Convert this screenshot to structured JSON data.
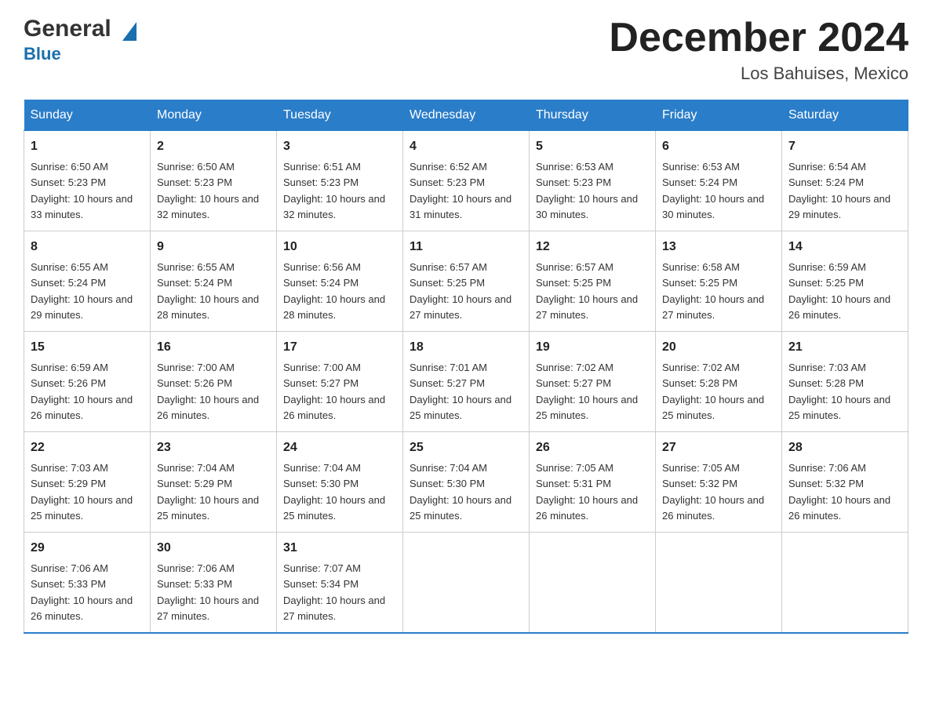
{
  "header": {
    "logo_general": "General",
    "logo_blue": "Blue",
    "month_title": "December 2024",
    "location": "Los Bahuises, Mexico"
  },
  "days_of_week": [
    "Sunday",
    "Monday",
    "Tuesday",
    "Wednesday",
    "Thursday",
    "Friday",
    "Saturday"
  ],
  "weeks": [
    [
      {
        "day": "1",
        "sunrise": "6:50 AM",
        "sunset": "5:23 PM",
        "daylight": "10 hours and 33 minutes."
      },
      {
        "day": "2",
        "sunrise": "6:50 AM",
        "sunset": "5:23 PM",
        "daylight": "10 hours and 32 minutes."
      },
      {
        "day": "3",
        "sunrise": "6:51 AM",
        "sunset": "5:23 PM",
        "daylight": "10 hours and 32 minutes."
      },
      {
        "day": "4",
        "sunrise": "6:52 AM",
        "sunset": "5:23 PM",
        "daylight": "10 hours and 31 minutes."
      },
      {
        "day": "5",
        "sunrise": "6:53 AM",
        "sunset": "5:23 PM",
        "daylight": "10 hours and 30 minutes."
      },
      {
        "day": "6",
        "sunrise": "6:53 AM",
        "sunset": "5:24 PM",
        "daylight": "10 hours and 30 minutes."
      },
      {
        "day": "7",
        "sunrise": "6:54 AM",
        "sunset": "5:24 PM",
        "daylight": "10 hours and 29 minutes."
      }
    ],
    [
      {
        "day": "8",
        "sunrise": "6:55 AM",
        "sunset": "5:24 PM",
        "daylight": "10 hours and 29 minutes."
      },
      {
        "day": "9",
        "sunrise": "6:55 AM",
        "sunset": "5:24 PM",
        "daylight": "10 hours and 28 minutes."
      },
      {
        "day": "10",
        "sunrise": "6:56 AM",
        "sunset": "5:24 PM",
        "daylight": "10 hours and 28 minutes."
      },
      {
        "day": "11",
        "sunrise": "6:57 AM",
        "sunset": "5:25 PM",
        "daylight": "10 hours and 27 minutes."
      },
      {
        "day": "12",
        "sunrise": "6:57 AM",
        "sunset": "5:25 PM",
        "daylight": "10 hours and 27 minutes."
      },
      {
        "day": "13",
        "sunrise": "6:58 AM",
        "sunset": "5:25 PM",
        "daylight": "10 hours and 27 minutes."
      },
      {
        "day": "14",
        "sunrise": "6:59 AM",
        "sunset": "5:25 PM",
        "daylight": "10 hours and 26 minutes."
      }
    ],
    [
      {
        "day": "15",
        "sunrise": "6:59 AM",
        "sunset": "5:26 PM",
        "daylight": "10 hours and 26 minutes."
      },
      {
        "day": "16",
        "sunrise": "7:00 AM",
        "sunset": "5:26 PM",
        "daylight": "10 hours and 26 minutes."
      },
      {
        "day": "17",
        "sunrise": "7:00 AM",
        "sunset": "5:27 PM",
        "daylight": "10 hours and 26 minutes."
      },
      {
        "day": "18",
        "sunrise": "7:01 AM",
        "sunset": "5:27 PM",
        "daylight": "10 hours and 25 minutes."
      },
      {
        "day": "19",
        "sunrise": "7:02 AM",
        "sunset": "5:27 PM",
        "daylight": "10 hours and 25 minutes."
      },
      {
        "day": "20",
        "sunrise": "7:02 AM",
        "sunset": "5:28 PM",
        "daylight": "10 hours and 25 minutes."
      },
      {
        "day": "21",
        "sunrise": "7:03 AM",
        "sunset": "5:28 PM",
        "daylight": "10 hours and 25 minutes."
      }
    ],
    [
      {
        "day": "22",
        "sunrise": "7:03 AM",
        "sunset": "5:29 PM",
        "daylight": "10 hours and 25 minutes."
      },
      {
        "day": "23",
        "sunrise": "7:04 AM",
        "sunset": "5:29 PM",
        "daylight": "10 hours and 25 minutes."
      },
      {
        "day": "24",
        "sunrise": "7:04 AM",
        "sunset": "5:30 PM",
        "daylight": "10 hours and 25 minutes."
      },
      {
        "day": "25",
        "sunrise": "7:04 AM",
        "sunset": "5:30 PM",
        "daylight": "10 hours and 25 minutes."
      },
      {
        "day": "26",
        "sunrise": "7:05 AM",
        "sunset": "5:31 PM",
        "daylight": "10 hours and 26 minutes."
      },
      {
        "day": "27",
        "sunrise": "7:05 AM",
        "sunset": "5:32 PM",
        "daylight": "10 hours and 26 minutes."
      },
      {
        "day": "28",
        "sunrise": "7:06 AM",
        "sunset": "5:32 PM",
        "daylight": "10 hours and 26 minutes."
      }
    ],
    [
      {
        "day": "29",
        "sunrise": "7:06 AM",
        "sunset": "5:33 PM",
        "daylight": "10 hours and 26 minutes."
      },
      {
        "day": "30",
        "sunrise": "7:06 AM",
        "sunset": "5:33 PM",
        "daylight": "10 hours and 27 minutes."
      },
      {
        "day": "31",
        "sunrise": "7:07 AM",
        "sunset": "5:34 PM",
        "daylight": "10 hours and 27 minutes."
      },
      null,
      null,
      null,
      null
    ]
  ]
}
